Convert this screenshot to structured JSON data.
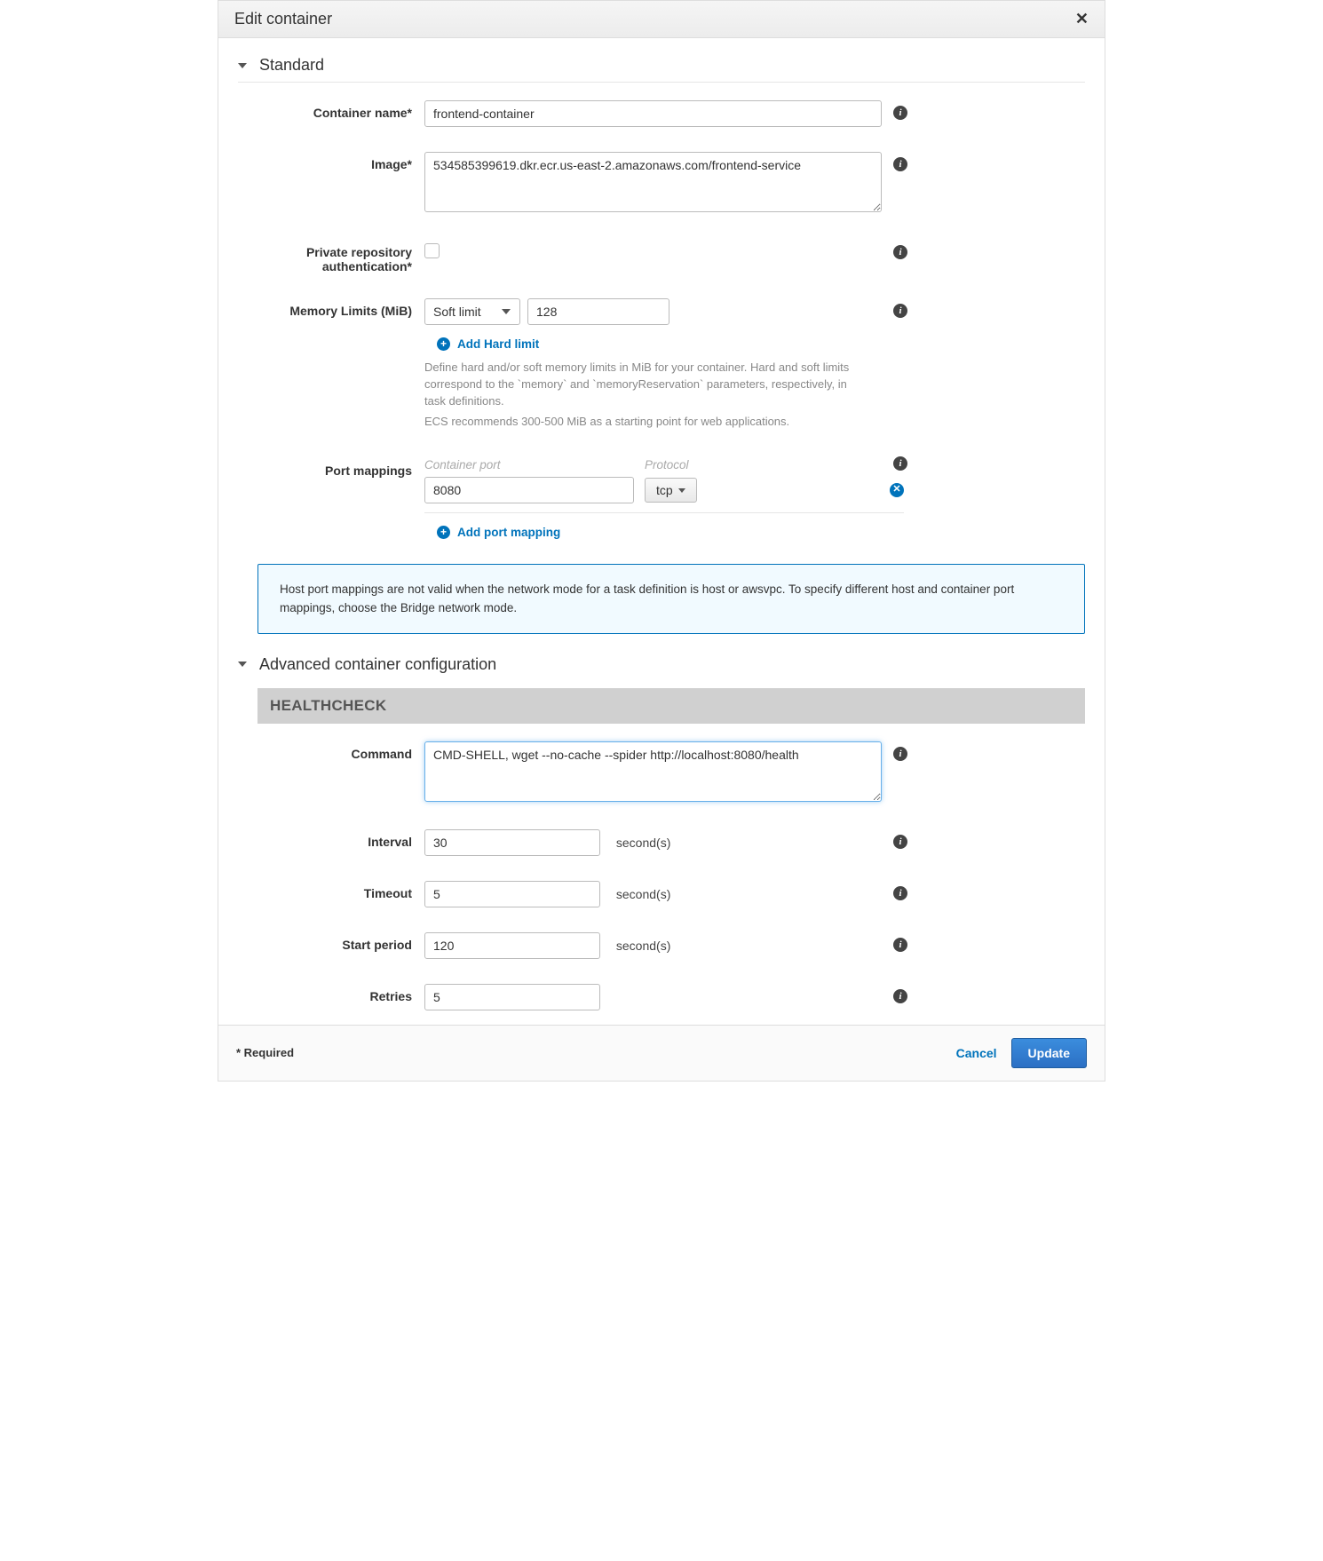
{
  "header": {
    "title": "Edit container"
  },
  "sections": {
    "standard": "Standard",
    "advanced": "Advanced container configuration"
  },
  "labels": {
    "container_name": "Container name*",
    "image": "Image*",
    "private_repo": "Private repository authentication*",
    "memory_limits": "Memory Limits (MiB)",
    "port_mappings": "Port mappings",
    "command": "Command",
    "interval": "Interval",
    "timeout": "Timeout",
    "start_period": "Start period",
    "retries": "Retries"
  },
  "values": {
    "container_name": "frontend-container",
    "image": "534585399619.dkr.ecr.us-east-2.amazonaws.com/frontend-service",
    "memory_limit_type": "Soft limit",
    "memory_limit_value": "128",
    "port_container": "8080",
    "port_protocol": "tcp",
    "hc_command": "CMD-SHELL, wget --no-cache --spider http://localhost:8080/health",
    "interval": "30",
    "timeout": "5",
    "start_period": "120",
    "retries": "5"
  },
  "columns": {
    "container_port": "Container port",
    "protocol": "Protocol"
  },
  "actions": {
    "add_hard_limit": "Add Hard limit",
    "add_port_mapping": "Add port mapping",
    "cancel": "Cancel",
    "update": "Update"
  },
  "help": {
    "memory": "Define hard and/or soft memory limits in MiB for your container. Hard and soft limits correspond to the `memory` and `memoryReservation` parameters, respectively, in task definitions.",
    "memory_rec": "ECS recommends 300-500 MiB as a starting point for web applications.",
    "port_info": "Host port mappings are not valid when the network mode for a task definition is host or awsvpc. To specify different host and container port mappings, choose the Bridge network mode."
  },
  "hc_header": "HEALTHCHECK",
  "suffix": {
    "seconds": "second(s)"
  },
  "footer": {
    "required": "* Required"
  }
}
